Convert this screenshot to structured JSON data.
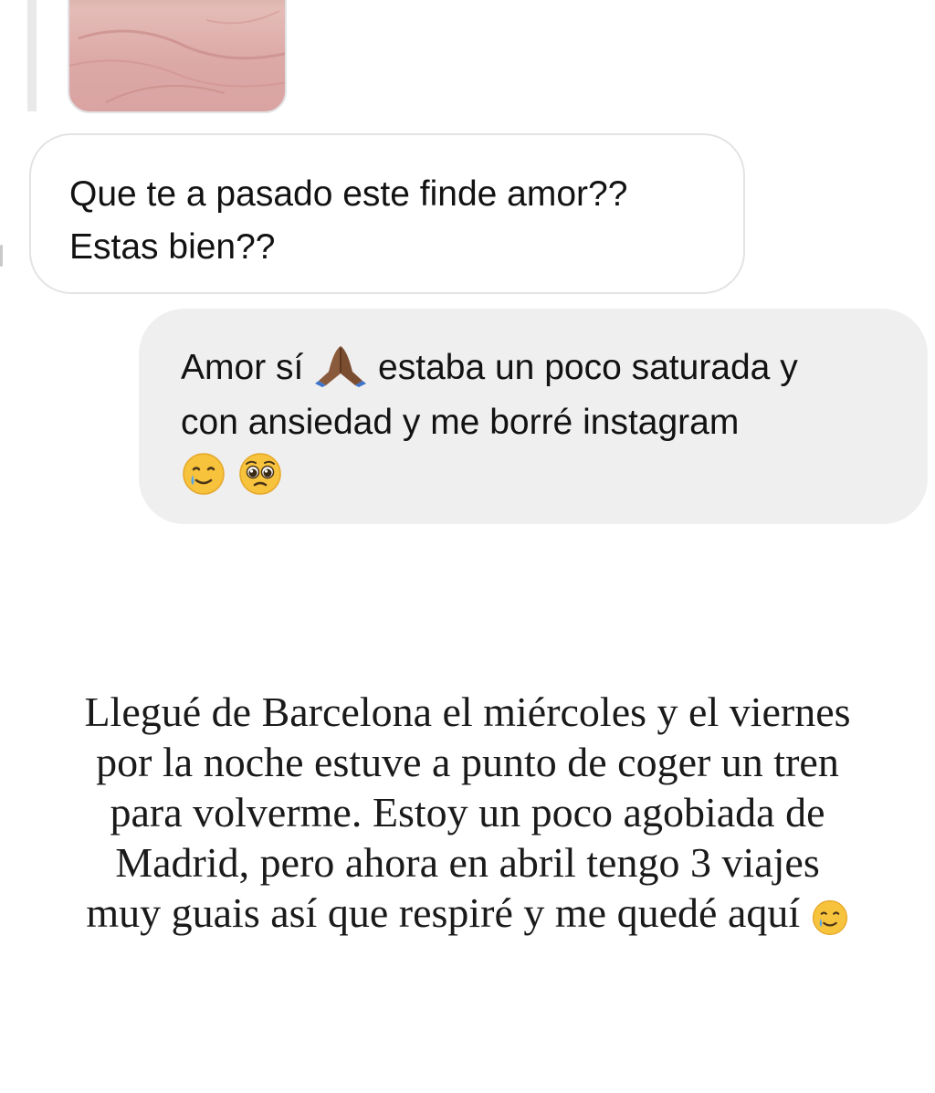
{
  "story_reply": {
    "thumbnail_icon": "story-photo-thumbnail"
  },
  "received_message": {
    "lines": [
      "Que te a pasado este finde amor??",
      "Estas bien??"
    ]
  },
  "sent_message": {
    "line1_before": "Amor sí",
    "line1_emoji": "folded-hands-icon",
    "line1_after": "estaba un poco saturada y",
    "line2": "con ansiedad y me borré instagram",
    "emojis": [
      "smiling-face-with-tear-icon",
      "pleading-face-icon"
    ]
  },
  "story_caption": {
    "lines": [
      "Llegué de Barcelona el miércoles y el viernes",
      "por la noche estuve a punto de coger un tren",
      "para volverme. Estoy un poco agobiada de",
      "Madrid, pero ahora en abril tengo 3 viajes",
      "muy guais así que respiré y me quedé aquí"
    ],
    "trailing_emoji": "smiling-face-with-tear-icon"
  },
  "colors": {
    "sent_bubble": "#efefef",
    "received_border": "#e3e3e5",
    "text": "#121212",
    "emoji_yellow": "#f7c23c"
  }
}
